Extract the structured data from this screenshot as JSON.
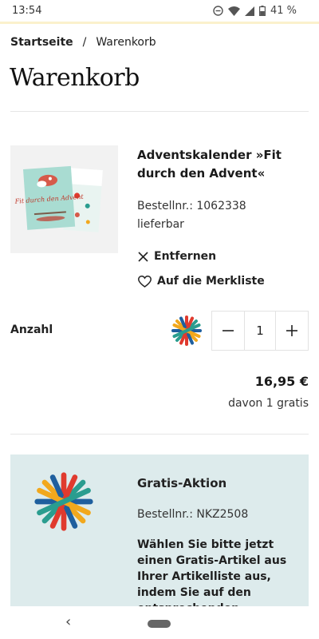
{
  "status_bar": {
    "time": "13:54",
    "battery": "41 %",
    "icons": [
      "do-not-disturb-icon",
      "wifi-icon",
      "signal-icon",
      "battery-icon"
    ]
  },
  "breadcrumb": {
    "home": "Startseite",
    "separator": "/",
    "current": "Warenkorb"
  },
  "page": {
    "title": "Warenkorb"
  },
  "cart_item": {
    "title": "Adventskalender »Fit durch den Advent«",
    "order_number": "Bestellnr.: 1062338",
    "availability": "lieferbar",
    "remove_label": "Entfernen",
    "wishlist_label": "Auf die Merkliste",
    "quantity_label": "Anzahl",
    "quantity": "1",
    "price": "16,95 €",
    "price_note": "davon 1 gratis",
    "image_text": "Fit durch den Advent"
  },
  "promo": {
    "title": "Gratis-Aktion",
    "order_number": "Bestellnr.: NKZ2508",
    "text": "Wählen Sie bitte jetzt einen Gratis-Artikel aus Ihrer Artikelliste aus, indem Sie auf den entsprechenden"
  },
  "colors": {
    "promo_background": "#ddebec",
    "status_border": "#fbf1cc",
    "logo_red": "#e03a2e",
    "logo_orange": "#f2a81d",
    "logo_blue": "#1f5f9e",
    "logo_teal": "#2a9d8f"
  }
}
